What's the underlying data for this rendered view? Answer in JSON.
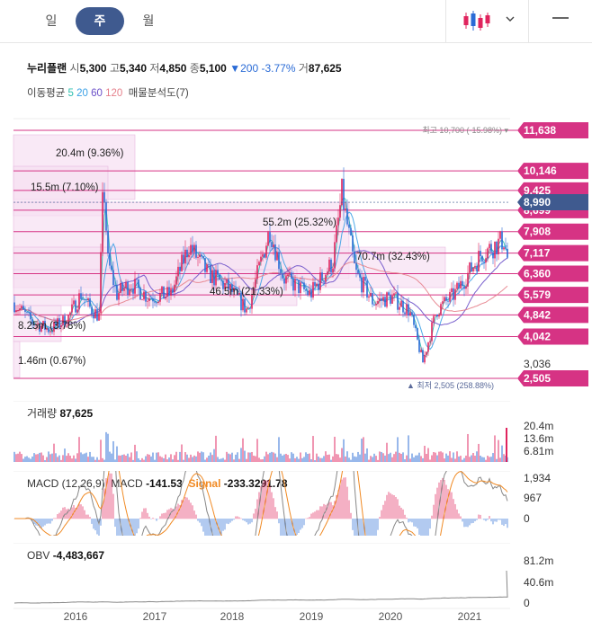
{
  "tabs": [
    {
      "label": "일",
      "active": false
    },
    {
      "label": "주",
      "active": true
    },
    {
      "label": "월",
      "active": false
    }
  ],
  "icons": {
    "chart_type": "candlestick-icon",
    "dropdown": "chevron-down-icon",
    "menu": "menu-icon"
  },
  "stock": {
    "name": "누리플랜",
    "open_label": "시",
    "open": "5,300",
    "high_label": "고",
    "high": "5,340",
    "low_label": "저",
    "low": "4,850",
    "close_label": "종",
    "close": "5,100",
    "change_arrow": "▼",
    "change": "200",
    "change_pct": "-3.77%",
    "volume_label": "거",
    "volume": "87,625"
  },
  "moving_average": {
    "label": "이동평균",
    "periods": [
      {
        "value": "5",
        "color": "#2bbfae"
      },
      {
        "value": "20",
        "color": "#3aa0e6"
      },
      {
        "value": "60",
        "color": "#6a4fc8"
      },
      {
        "value": "120",
        "color": "#e57f8a"
      }
    ],
    "volume_profile_label": "매물분석도(7)"
  },
  "colors": {
    "up": "#e0245e",
    "down": "#2a6bd6",
    "accent": "#3f5a8f",
    "profile_line": "#d63384",
    "profile_fill": "#f6dff2",
    "signal": "#f08a24",
    "macd": "#888888"
  },
  "chart_data": [
    {
      "type": "candlestick",
      "x_ticks": [
        "2016",
        "2017",
        "2018",
        "2019",
        "2020",
        "2021"
      ],
      "y_ticks": [
        "11,638",
        "10,146",
        "9,425",
        "8,699",
        "7,908",
        "7,117",
        "6,360",
        "5,579",
        "4,842",
        "4,042",
        "3,036",
        "2,505"
      ],
      "current_price": "8,990",
      "high_annotation": "최고 10,700 (-15.98%)",
      "low_annotation": "최저 2,505 (258.88%)",
      "volume_profile": [
        {
          "label": "20.4m (9.36%)",
          "level": 10146
        },
        {
          "label": "15.5m (7.10%)",
          "level": 9425
        },
        {
          "label": "55.2m (25.32%)",
          "level": 7908
        },
        {
          "label": "70.7m (32.43%)",
          "level": 6360
        },
        {
          "label": "46.5m (21.33%)",
          "level": 5579
        },
        {
          "label": "8.25m (3.78%)",
          "level": 4842
        },
        {
          "label": "1.46m (0.67%)",
          "level": 3036
        }
      ]
    },
    {
      "type": "bar",
      "title": "거래량",
      "value": "87,625",
      "y_ticks": [
        "20.4m",
        "13.6m",
        "6.81m"
      ]
    },
    {
      "type": "line",
      "title": "MACD (12,26,9)",
      "macd_label": "MACD",
      "macd_value": "-141.53",
      "signal_label": "Signal",
      "signal_value": "-233.3291.78",
      "y_ticks": [
        "1,934",
        "967",
        "0"
      ]
    },
    {
      "type": "line",
      "title": "OBV",
      "value": "-4,483,667",
      "y_ticks": [
        "81.2m",
        "40.6m",
        "0"
      ]
    }
  ]
}
